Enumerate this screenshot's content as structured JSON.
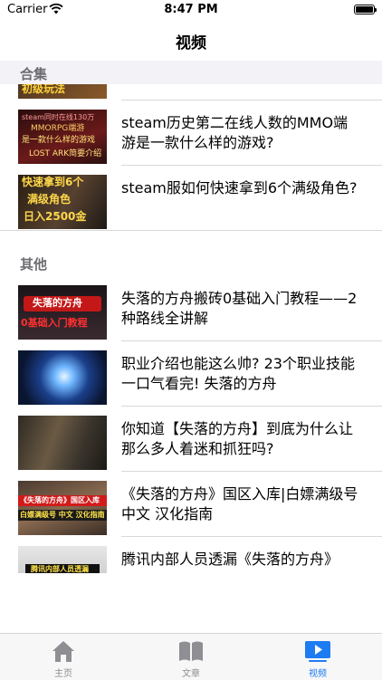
{
  "status": {
    "carrier": "Carrier",
    "time": "8:47 PM"
  },
  "nav": {
    "title": "视频"
  },
  "sections": [
    {
      "header": "合集",
      "items": [
        {
          "title": "",
          "thumb_text": [
            "初级玩法"
          ]
        },
        {
          "title": "steam历史第二在线人数的MMO端游是一款什么样的游戏?",
          "thumb_text": [
            "steam同时在线130万",
            "MMORPG端游",
            "是一款什么样的游戏",
            "LOST ARK简要介绍"
          ]
        },
        {
          "title": "steam服如何快速拿到6个满级角色?",
          "thumb_text": [
            "快速拿到6个",
            "满级角色",
            "日入2500金"
          ]
        }
      ]
    },
    {
      "header": "其他",
      "items": [
        {
          "title": "失落的方舟搬砖0基础入门教程——2种路线全讲解",
          "thumb_text": [
            "失落的方舟",
            "0基础入门教程"
          ]
        },
        {
          "title": "职业介绍也能这么帅? 23个职业技能一口气看完! 失落的方舟",
          "thumb_text": []
        },
        {
          "title": "你知道【失落的方舟】到底为什么让那么多人着迷和抓狂吗?",
          "thumb_text": []
        },
        {
          "title": "《失落的方舟》国区入库|白嫖满级号 中文 汉化指南",
          "thumb_text": [
            "《失落的方舟》国区入库",
            "白嫖满级号 中文 汉化指南"
          ]
        },
        {
          "title": "腾讯内部人员透漏《失落的方舟》",
          "thumb_text": [
            "腾讯内部人员透漏"
          ]
        }
      ]
    }
  ],
  "tabs": [
    {
      "label": "主页",
      "icon": "home-icon",
      "active": false
    },
    {
      "label": "文章",
      "icon": "book-icon",
      "active": false
    },
    {
      "label": "视频",
      "icon": "play-icon",
      "active": true
    }
  ],
  "colors": {
    "accent": "#1e7cf2",
    "inactive": "#8e8e93",
    "section_bg": "#f2f2f7"
  }
}
